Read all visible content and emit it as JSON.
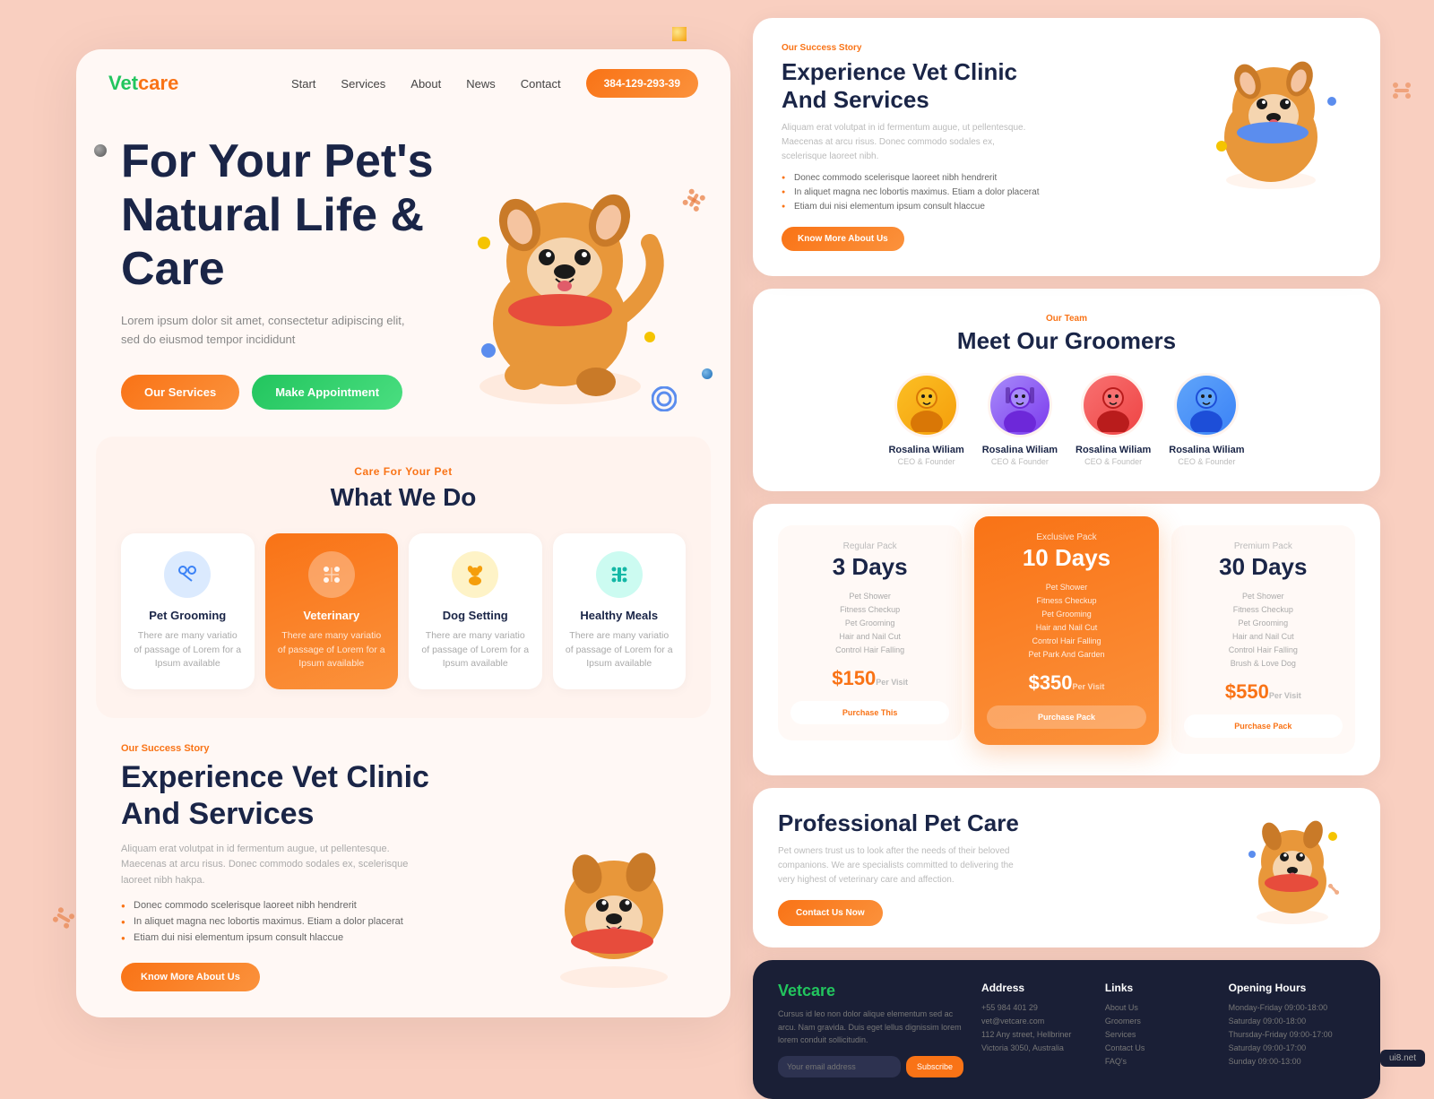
{
  "site": {
    "logo_first": "Vet",
    "logo_second": "care",
    "phone": "384-129-293-39"
  },
  "nav": {
    "start": "Start",
    "services": "Services",
    "about": "About",
    "news": "News",
    "contact": "Contact"
  },
  "hero": {
    "title": "For Your Pet's Natural Life & Care",
    "description": "Lorem ipsum dolor sit amet, consectetur adipiscing elit, sed do eiusmod tempor incididunt",
    "btn_services": "Our Services",
    "btn_appointment": "Make Appointment"
  },
  "services": {
    "tag": "Care For Your Pet",
    "title": "What We Do",
    "cards": [
      {
        "name": "Pet Grooming",
        "icon": "✂",
        "desc": "There are many variatio of passage of Lorem for a Ipsum available",
        "active": false
      },
      {
        "name": "Veterinary",
        "icon": "🐾",
        "desc": "There are many variatio of passage of Lorem for a Ipsum available",
        "active": true
      },
      {
        "name": "Dog Setting",
        "icon": "🐶",
        "desc": "There are many variatio of passage of Lorem for a Ipsum available",
        "active": false
      },
      {
        "name": "Healthy Meals",
        "icon": "🍖",
        "desc": "There are many variatio of passage of Lorem for a Ipsum available",
        "active": false
      }
    ]
  },
  "success": {
    "tag": "Our Success Story",
    "title_line1": "Experience Vet Clinic",
    "title_line2": "And Services",
    "description": "Aliquam erat volutpat in id fermentum augue, ut pellentesque. Maecenas at arcu risus. Donec commodo sodales ex, scelerisque laoreet nibh hakpa.",
    "items": [
      "Donec commodo scelerisque laoreet nibh hendrerit",
      "In aliquet magna nec lobortis maximus. Etiam a dolor placerat",
      "Etiam dui nisi elementum ipsum consult hlaccue"
    ],
    "btn": "Know More About Us"
  },
  "vet_clinic": {
    "tag": "Our Success Story",
    "title_line1": "Experience Vet Clinic",
    "title_line2": "And Services",
    "description": "Aliquam erat volutpat in id fermentum augue, ut pellentesque. Maecenas at arcu risus. Donec commodo sodales ex, scelerisque laoreet nibh.",
    "items": [
      "Donec commodo scelerisque laoreet nibh hendrerit",
      "In aliquet magna nec lobortis maximus. Etiam a dolor placerat",
      "Etiam dui nisi elementum ipsum consult hlaccue"
    ],
    "btn": "Know More About Us"
  },
  "team": {
    "tag": "Our Team",
    "title": "Meet Our Groomers",
    "members": [
      {
        "name": "Rosalina Wiliam",
        "role": "CEO & Founder",
        "emoji": "👨"
      },
      {
        "name": "Rosalina Wiliam",
        "role": "CEO & Founder",
        "emoji": "👩"
      },
      {
        "name": "Rosalina Wiliam",
        "role": "CEO & Founder",
        "emoji": "👨"
      },
      {
        "name": "Rosalina Wiliam",
        "role": "CEO & Founder",
        "emoji": "👨"
      }
    ]
  },
  "pricing": {
    "plans": [
      {
        "label": "Regular Pack",
        "days": "3 Days",
        "features": [
          "Pet Shower",
          "Fitness Checkup",
          "Pet Grooming",
          "Hair and Nail Cut",
          "Control Hair Falling"
        ],
        "price": "$150",
        "per": "Per Visit",
        "featured": false,
        "btn": "Purchase This"
      },
      {
        "label": "Exclusive Pack",
        "days": "10 Days",
        "features": [
          "Pet Shower",
          "Fitness Checkup",
          "Pet Grooming",
          "Hair and Nail Cut",
          "Control Hair Falling",
          "Pet Park And Garden"
        ],
        "price": "$350",
        "per": "Per Visit",
        "featured": true,
        "btn": "Purchase Pack"
      },
      {
        "label": "Premium Pack",
        "days": "30 Days",
        "features": [
          "Pet Shower",
          "Fitness Checkup",
          "Pet Grooming",
          "Hair and Nail Cut",
          "Control Hair Falling",
          "Brush & Love Dog"
        ],
        "price": "$550",
        "per": "Per Visit",
        "featured": false,
        "btn": "Purchase Pack"
      }
    ]
  },
  "procare": {
    "title": "Professional Pet Care",
    "description": "Pet owners trust us to look after the needs of their beloved companions. We are specialists committed to delivering the very highest of veterinary care and affection.",
    "btn": "Contact Us Now"
  },
  "footer": {
    "logo_first": "Vet",
    "logo_second": "care",
    "about": "Cursus id leo non dolor alique elementum sed ac arcu. Nam gravida. Duis eget lellus dignissim lorem lorem conduit sollicitudin.",
    "email_placeholder": "Your email address",
    "subscribe_btn": "Subscribe",
    "address_title": "Address",
    "address_items": [
      "+55 984 401 29",
      "vet@vetcare.com",
      "112 Any street, Hellbriner",
      "Victoria 3050, Australia"
    ],
    "links_title": "Links",
    "links_items": [
      "About Us",
      "Groomers",
      "Services",
      "Contact Us",
      "FAQ's"
    ],
    "hours_title": "Opening Hours",
    "hours_items": [
      "Monday-Friday 09:00-18:00",
      "Saturday 09:00-18:00",
      "Thursday-Friday 09:00-17:00",
      "Saturday 09:00-17:00",
      "Sunday 09:00-13:00"
    ]
  }
}
